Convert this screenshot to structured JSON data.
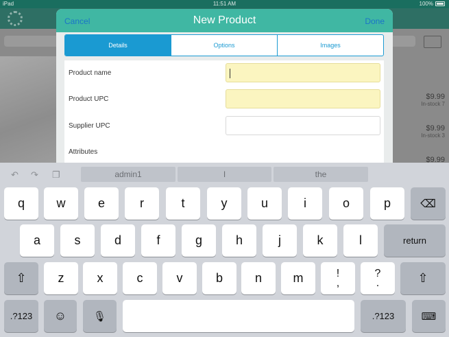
{
  "status_bar": {
    "carrier": "iPad",
    "time": "11:51 AM",
    "battery": "100%"
  },
  "background": {
    "prices": [
      {
        "price": "$9.99",
        "stock": "In-stock 7"
      },
      {
        "price": "$9.99",
        "stock": "In-stock 3"
      },
      {
        "price": "$9.99",
        "stock": ""
      }
    ]
  },
  "modal": {
    "cancel": "Cancel",
    "title": "New Product",
    "done": "Done",
    "tabs": [
      "Details",
      "Options",
      "Images"
    ],
    "fields": [
      {
        "label": "Product name",
        "value": ""
      },
      {
        "label": "Product UPC",
        "value": ""
      },
      {
        "label": "Supplier UPC",
        "value": ""
      }
    ],
    "attributes_label": "Attributes"
  },
  "keyboard": {
    "predictions": [
      "admin1",
      "I",
      "the"
    ],
    "row1": [
      "q",
      "w",
      "e",
      "r",
      "t",
      "y",
      "u",
      "i",
      "o",
      "p"
    ],
    "row2": [
      "a",
      "s",
      "d",
      "f",
      "g",
      "h",
      "j",
      "k",
      "l"
    ],
    "row3": [
      "z",
      "x",
      "c",
      "v",
      "b",
      "n",
      "m"
    ],
    "punct1": [
      "!",
      ","
    ],
    "punct2": [
      "?",
      "."
    ],
    "return": "return",
    "numbers": ".?123"
  }
}
